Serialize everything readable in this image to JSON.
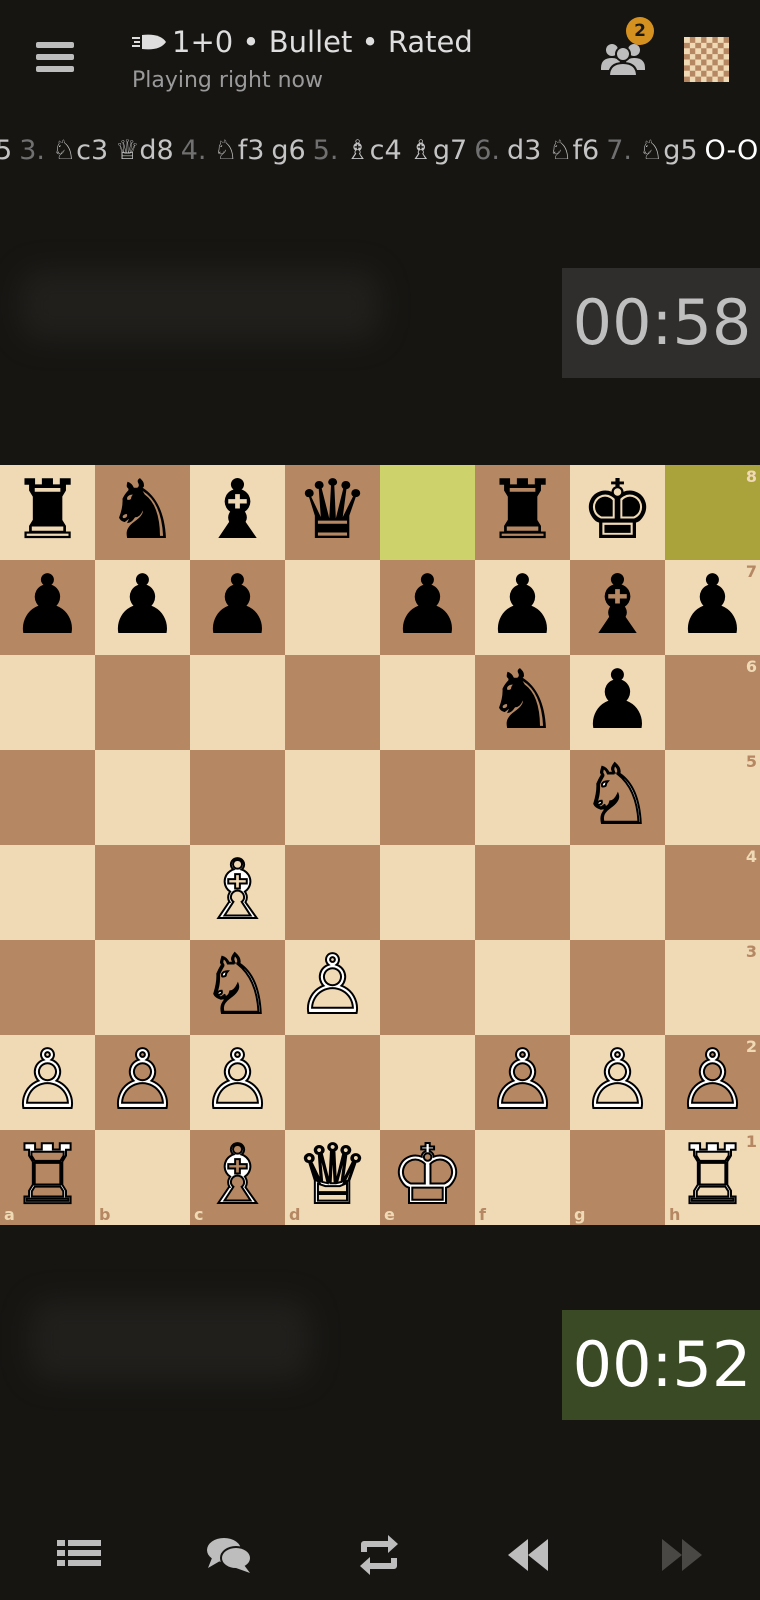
{
  "header": {
    "game_title": "1+0 • Bullet • Rated",
    "status": "Playing right now",
    "friends_badge": "2"
  },
  "move_list": [
    {
      "t": "5",
      "k": "mv"
    },
    {
      "t": "3.",
      "k": "num"
    },
    {
      "t": "♘c3",
      "k": "mv"
    },
    {
      "t": "♕d8",
      "k": "mv"
    },
    {
      "t": "4.",
      "k": "num"
    },
    {
      "t": "♘f3",
      "k": "mv"
    },
    {
      "t": "g6",
      "k": "mv"
    },
    {
      "t": "5.",
      "k": "num"
    },
    {
      "t": "♗c4",
      "k": "mv"
    },
    {
      "t": "♗g7",
      "k": "mv"
    },
    {
      "t": "6.",
      "k": "num"
    },
    {
      "t": "d3",
      "k": "mv"
    },
    {
      "t": "♘f6",
      "k": "mv"
    },
    {
      "t": "7.",
      "k": "num"
    },
    {
      "t": "♘g5",
      "k": "mv"
    },
    {
      "t": "O-O",
      "k": "cur"
    }
  ],
  "clocks": {
    "opponent": "00:58",
    "player": "00:52"
  },
  "board": {
    "ranks": [
      "8",
      "7",
      "6",
      "5",
      "4",
      "3",
      "2",
      "1"
    ],
    "files": [
      "a",
      "b",
      "c",
      "d",
      "e",
      "f",
      "g",
      "h"
    ],
    "highlight": [
      "e8",
      "h8"
    ],
    "pieces": {
      "a8": {
        "g": "♜",
        "c": "b"
      },
      "b8": {
        "g": "♞",
        "c": "b"
      },
      "c8": {
        "g": "♝",
        "c": "b"
      },
      "d8": {
        "g": "♛",
        "c": "b"
      },
      "f8": {
        "g": "♜",
        "c": "b"
      },
      "g8": {
        "g": "♚",
        "c": "b"
      },
      "a7": {
        "g": "♟",
        "c": "b"
      },
      "b7": {
        "g": "♟",
        "c": "b"
      },
      "c7": {
        "g": "♟",
        "c": "b"
      },
      "e7": {
        "g": "♟",
        "c": "b"
      },
      "f7": {
        "g": "♟",
        "c": "b"
      },
      "g7": {
        "g": "♝",
        "c": "b"
      },
      "h7": {
        "g": "♟",
        "c": "b"
      },
      "f6": {
        "g": "♞",
        "c": "b"
      },
      "g6": {
        "g": "♟",
        "c": "b"
      },
      "g5": {
        "g": "♘",
        "c": "w"
      },
      "c4": {
        "g": "♗",
        "c": "w"
      },
      "c3": {
        "g": "♘",
        "c": "w"
      },
      "d3": {
        "g": "♙",
        "c": "w"
      },
      "a2": {
        "g": "♙",
        "c": "w"
      },
      "b2": {
        "g": "♙",
        "c": "w"
      },
      "c2": {
        "g": "♙",
        "c": "w"
      },
      "f2": {
        "g": "♙",
        "c": "w"
      },
      "g2": {
        "g": "♙",
        "c": "w"
      },
      "h2": {
        "g": "♙",
        "c": "w"
      },
      "a1": {
        "g": "♖",
        "c": "w"
      },
      "c1": {
        "g": "♗",
        "c": "w"
      },
      "d1": {
        "g": "♕",
        "c": "w"
      },
      "e1": {
        "g": "♔",
        "c": "w"
      },
      "h1": {
        "g": "♖",
        "c": "w"
      }
    }
  },
  "colors": {
    "background": "#161512",
    "light_square": "#f0d9b5",
    "dark_square": "#b58863",
    "badge": "#d59120",
    "active_clock": "#3a4a24"
  },
  "icons": {
    "menu": "hamburger-icon",
    "bullet": "bullet-icon",
    "friends": "friends-icon",
    "board": "board-icon",
    "nav": [
      "list-icon",
      "chat-icon",
      "flip-board-icon",
      "rewind-icon",
      "forward-icon"
    ]
  }
}
